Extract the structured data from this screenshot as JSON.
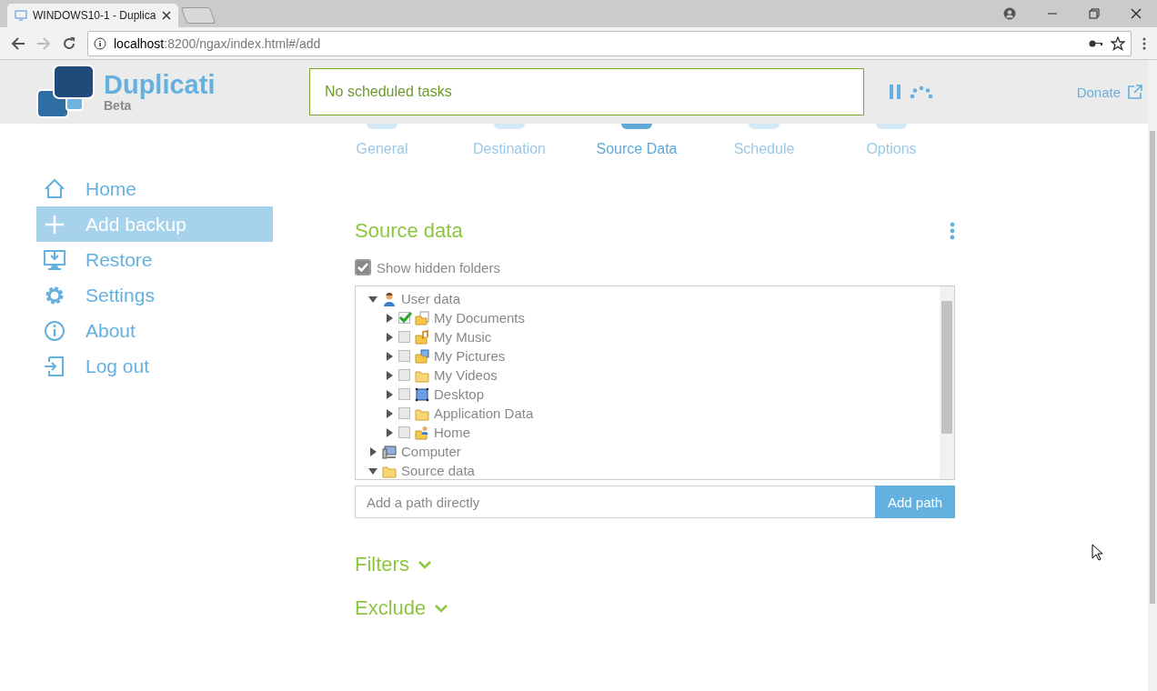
{
  "browser": {
    "tab_title": "WINDOWS10-1 - Duplica",
    "url_host": "localhost",
    "url_rest": ":8200/ngax/index.html#/add"
  },
  "header": {
    "app_name": "Duplicati",
    "edition": "Beta",
    "status": "No scheduled tasks",
    "donate": "Donate"
  },
  "steps": [
    {
      "label": "General",
      "selected": false
    },
    {
      "label": "Destination",
      "selected": false
    },
    {
      "label": "Source Data",
      "selected": true
    },
    {
      "label": "Schedule",
      "selected": false
    },
    {
      "label": "Options",
      "selected": false
    }
  ],
  "menu": [
    {
      "label": "Home",
      "kind": "home",
      "selected": false
    },
    {
      "label": "Add backup",
      "kind": "add",
      "selected": true
    },
    {
      "label": "Restore",
      "kind": "restore",
      "selected": false
    },
    {
      "label": "Settings",
      "kind": "settings",
      "selected": false
    },
    {
      "label": "About",
      "kind": "about",
      "selected": false
    },
    {
      "label": "Log out",
      "kind": "logout",
      "selected": false
    }
  ],
  "source": {
    "title": "Source data",
    "show_hidden": {
      "label": "Show hidden folders",
      "checked": true
    },
    "tree": [
      {
        "label": "User data",
        "kind": "user",
        "expanded": true,
        "children": [
          {
            "label": "My Documents",
            "kind": "documents",
            "checked": true,
            "expanded": false
          },
          {
            "label": "My Music",
            "kind": "music",
            "checked": false,
            "expanded": false
          },
          {
            "label": "My Pictures",
            "kind": "pictures",
            "checked": false,
            "expanded": false
          },
          {
            "label": "My Videos",
            "kind": "folder",
            "checked": false,
            "expanded": false
          },
          {
            "label": "Desktop",
            "kind": "desktop",
            "checked": false,
            "expanded": false
          },
          {
            "label": "Application Data",
            "kind": "folder",
            "checked": false,
            "expanded": false
          },
          {
            "label": "Home",
            "kind": "home",
            "checked": false,
            "expanded": false
          }
        ]
      },
      {
        "label": "Computer",
        "kind": "computer",
        "expanded": false
      },
      {
        "label": "Source data",
        "kind": "folder",
        "expanded": true
      }
    ],
    "path_placeholder": "Add a path directly",
    "add_button": "Add path"
  },
  "sections": [
    {
      "label": "Filters",
      "expanded": false
    },
    {
      "label": "Exclude",
      "expanded": false
    }
  ]
}
